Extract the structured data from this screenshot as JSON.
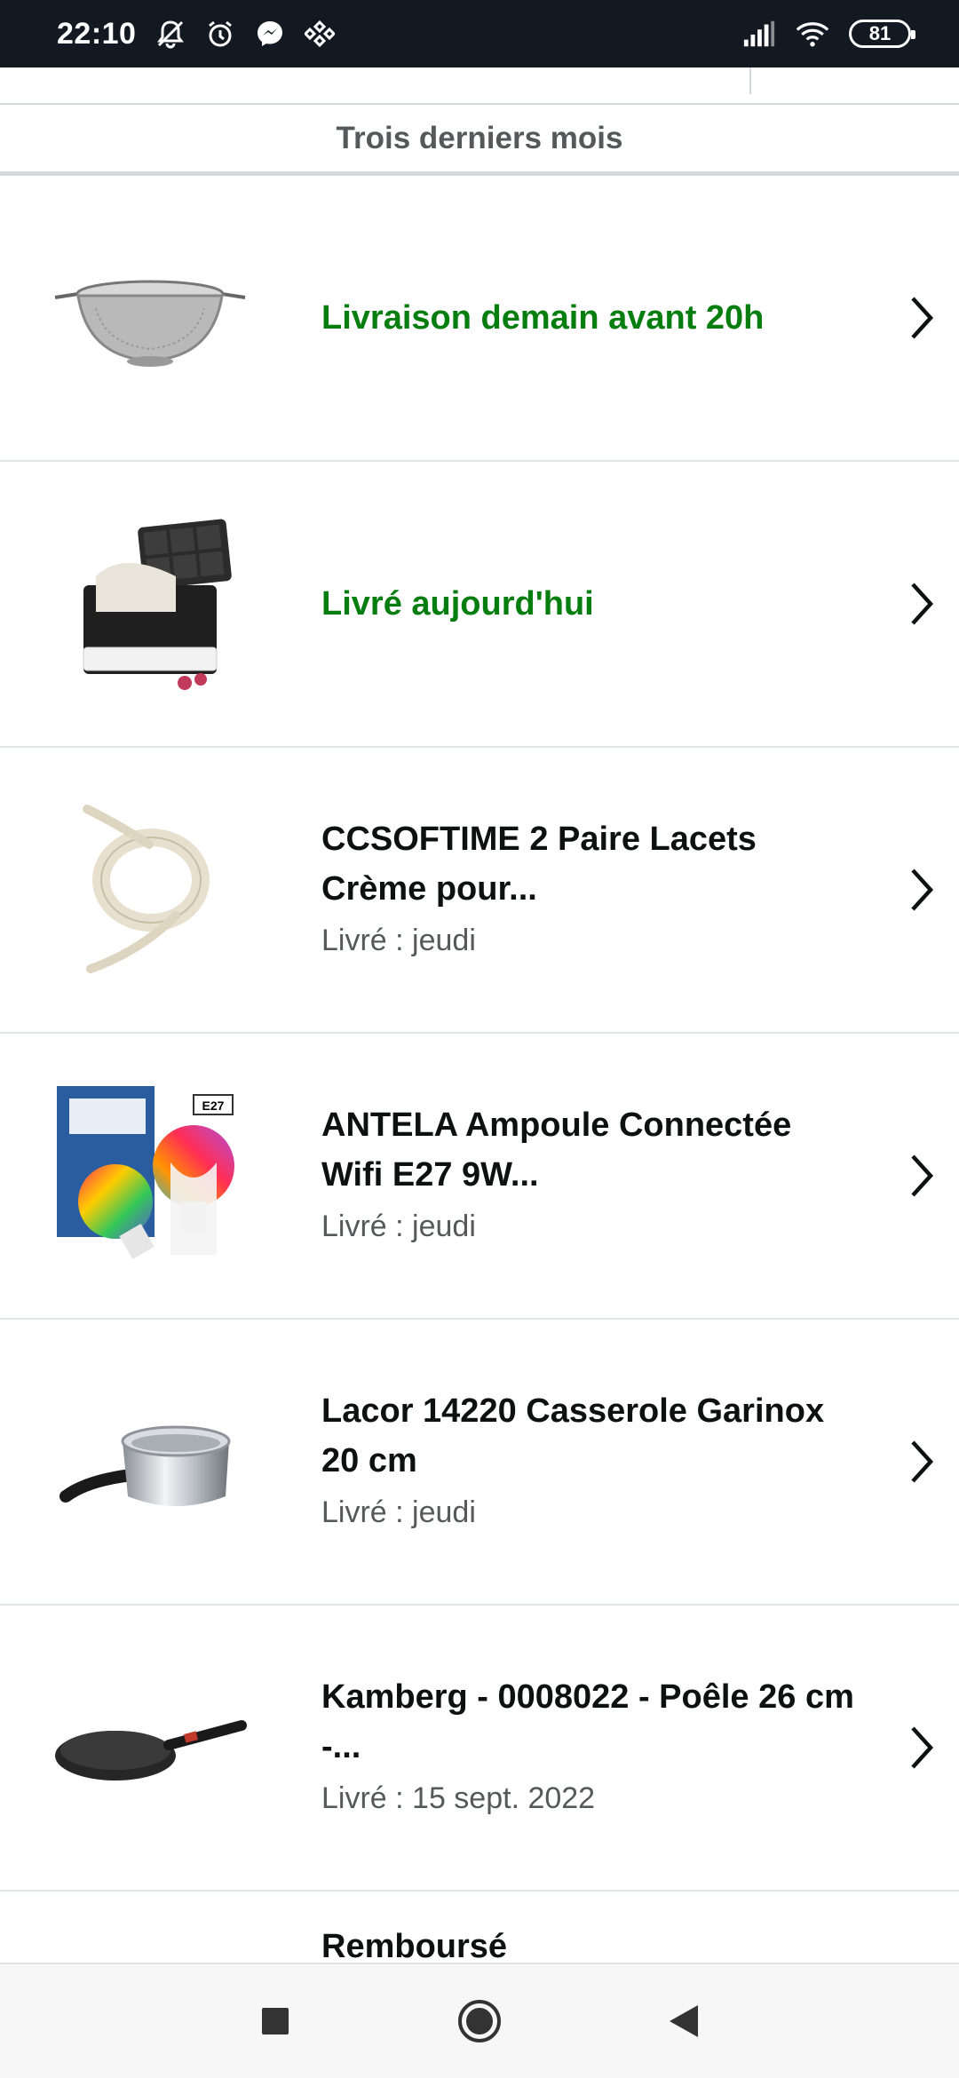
{
  "status_bar": {
    "time": "22:10",
    "icons": [
      "bell-off-icon",
      "alarm-icon",
      "messenger-icon",
      "binance-icon"
    ],
    "right_icons": [
      "signal-icon",
      "wifi-icon"
    ],
    "battery": "81"
  },
  "filter_header": {
    "label": "Trois derniers mois"
  },
  "orders": [
    {
      "title": "Livraison demain avant 20h",
      "status": "",
      "title_style": "green",
      "image": "colander"
    },
    {
      "title": "Livré aujourd'hui",
      "status": "",
      "title_style": "green",
      "image": "ice-tray"
    },
    {
      "title": "CCSOFTIME 2 Paire Lacets Crème pour...",
      "status": "Livré : jeudi",
      "title_style": "normal",
      "image": "laces"
    },
    {
      "title": "ANTELA Ampoule Connectée Wifi E27 9W...",
      "status": "Livré : jeudi",
      "title_style": "normal",
      "image": "bulbs"
    },
    {
      "title": "Lacor 14220 Casserole Garinox 20 cm",
      "status": "Livré : jeudi",
      "title_style": "normal",
      "image": "saucepan"
    },
    {
      "title": "Kamberg - 0008022 - Poêle 26 cm -...",
      "status": "Livré : 15 sept. 2022",
      "title_style": "normal",
      "image": "frying-pan"
    },
    {
      "title": "Remboursé",
      "status": "",
      "title_style": "normal",
      "image": "power-strip"
    }
  ],
  "colors": {
    "status_bar_bg": "#131921",
    "delivery_green": "#067d0f",
    "secondary_text": "#565959"
  },
  "nav_bar": {
    "buttons": [
      "recents-square-icon",
      "home-circle-icon",
      "back-triangle-icon"
    ]
  }
}
